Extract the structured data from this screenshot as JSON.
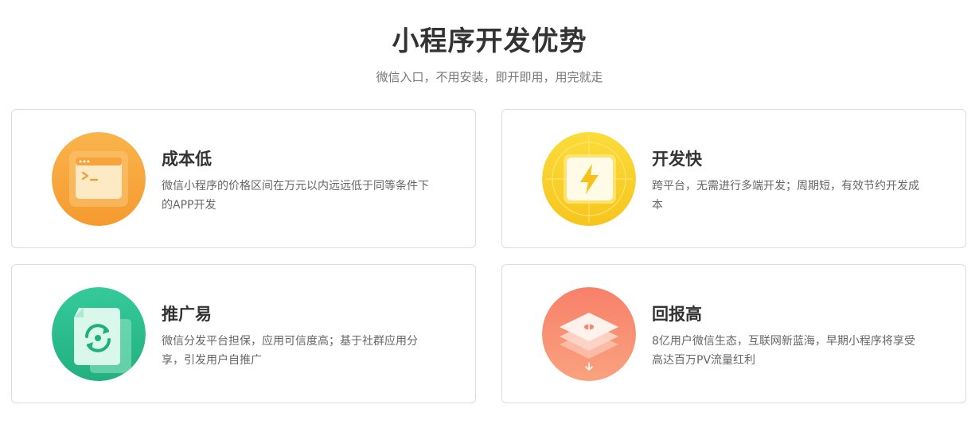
{
  "header": {
    "title": "小程序开发优势",
    "subtitle": "微信入口，不用安装，即开即用，用完就走"
  },
  "cards": [
    {
      "title": "成本低",
      "desc": "微信小程序的价格区间在万元以内远远低于同等条件下的APP开发",
      "icon": "terminal-window-icon",
      "color": "#f7a53a"
    },
    {
      "title": "开发快",
      "desc": "跨平台，无需进行多端开发；周期短，有效节约开发成本",
      "icon": "lightning-icon",
      "color": "#f9d12c"
    },
    {
      "title": "推广易",
      "desc": "微信分发平台担保，应用可信度高；基于社群应用分享，引发用户自推广",
      "icon": "sync-document-icon",
      "color": "#2dbf8e"
    },
    {
      "title": "回报高",
      "desc": "8亿用户微信生态，互联网新蓝海，早期小程序将享受高达百万PV流量红利",
      "icon": "layers-icon",
      "color": "#f7866c"
    }
  ]
}
